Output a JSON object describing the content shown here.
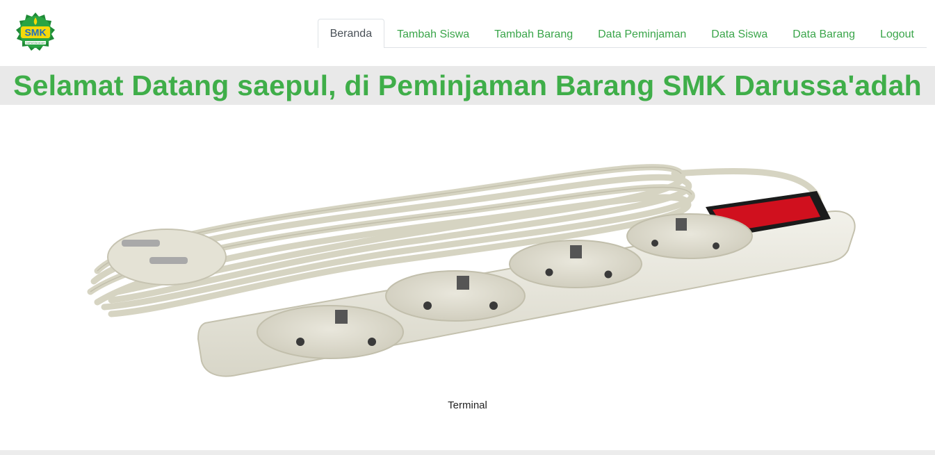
{
  "logo": {
    "text": "SMK",
    "subtext": "DARUSSA'ADAH"
  },
  "nav": {
    "items": [
      {
        "label": "Beranda",
        "active": true
      },
      {
        "label": "Tambah Siswa",
        "active": false
      },
      {
        "label": "Tambah Barang",
        "active": false
      },
      {
        "label": "Data Peminjaman",
        "active": false
      },
      {
        "label": "Data Siswa",
        "active": false
      },
      {
        "label": "Data Barang",
        "active": false
      },
      {
        "label": "Logout",
        "active": false
      }
    ]
  },
  "banner": {
    "title": "Selamat Datang saepul, di Peminjaman Barang SMK Darussa'adah"
  },
  "product": {
    "caption": "Terminal",
    "icon": "power-strip-image"
  },
  "colors": {
    "accent": "#3fae49",
    "banner_bg": "#e9e9e9",
    "switch": "#d0101e"
  }
}
